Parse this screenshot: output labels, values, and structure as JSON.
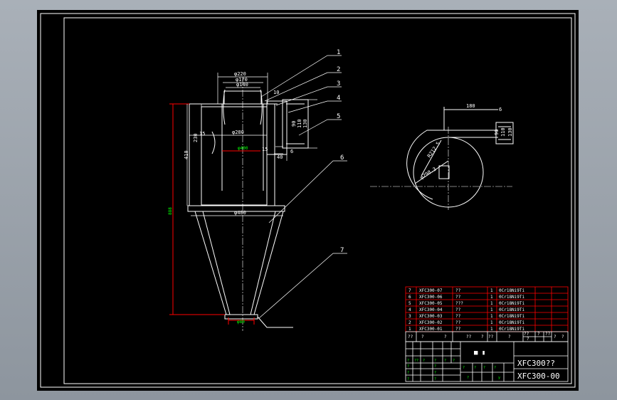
{
  "colors": {
    "background": "#000000",
    "line": "#ffffff",
    "dimension": "#ff0000",
    "accent": "#00ff00",
    "chrome": "#9aa1a9"
  },
  "front_view": {
    "dims": {
      "d_top_220": "φ220",
      "d_170": "φ170",
      "d_140": "φ140",
      "d_280": "φ280",
      "d_inner": "φ400",
      "d_bottom": "φ400",
      "d_outlet": "φ80",
      "h_230": "230",
      "h_410": "410",
      "h_total": "888",
      "w_15a": "15",
      "w_15b": "15",
      "r_10": "10",
      "r_40": "40",
      "r_6": "6",
      "inlet_90": "90",
      "inlet_110": "110",
      "inlet_130": "130"
    },
    "balloons": [
      "1",
      "2",
      "3",
      "4",
      "5",
      "6",
      "7"
    ]
  },
  "top_view": {
    "dims": {
      "len_180": "180",
      "w_6": "6",
      "h_90": "90",
      "h_110": "110",
      "h_130": "130",
      "r_large": "R212.5",
      "r_small": "φ298.3"
    }
  },
  "bom": {
    "rows": [
      {
        "no": "7",
        "code": "XFC300-07",
        "name": "??",
        "qty": "1",
        "material": "0Cr18Ni9Ti"
      },
      {
        "no": "6",
        "code": "XFC300-06",
        "name": "??",
        "qty": "1",
        "material": "0Cr18Ni9Ti"
      },
      {
        "no": "5",
        "code": "XFC300-05",
        "name": "???",
        "qty": "1",
        "material": "0Cr18Ni9Ti"
      },
      {
        "no": "4",
        "code": "XFC300-04",
        "name": "??",
        "qty": "1",
        "material": "0Cr18Ni9Ti"
      },
      {
        "no": "3",
        "code": "XFC300-03",
        "name": "??",
        "qty": "1",
        "material": "0Cr18Ni9Ti"
      },
      {
        "no": "2",
        "code": "XFC300-02",
        "name": "??",
        "qty": "1",
        "material": "0Cr18Ni9Ti"
      },
      {
        "no": "1",
        "code": "XFC300-01",
        "name": "??",
        "qty": "1",
        "material": "0Cr18Ni9Ti"
      }
    ],
    "header": [
      "??",
      "?",
      "?",
      "??",
      "?",
      "??",
      "?",
      "??",
      "?",
      "??",
      "?",
      "?",
      "?"
    ]
  },
  "title_block": {
    "title": "XFC300??",
    "drawing_no": "XFC300-00",
    "company_mark": "■ ▮",
    "small_labels": [
      "?",
      "??",
      "?",
      "?",
      "?",
      "?",
      "?",
      "?",
      "?",
      "?",
      "?",
      "?",
      "?",
      "?",
      "?",
      "?",
      "?",
      "y"
    ]
  }
}
